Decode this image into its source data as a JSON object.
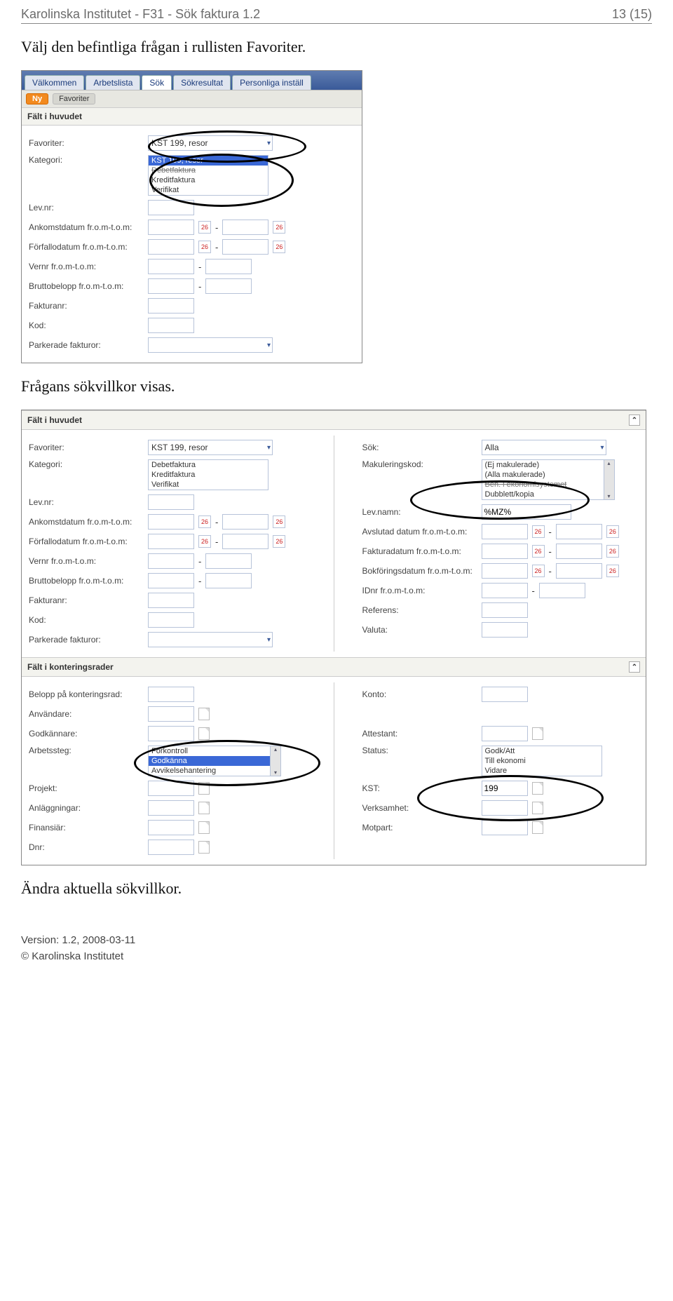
{
  "doc_header": {
    "title": "Karolinska Institutet - F31 - Sök faktura 1.2",
    "page_indicator": "13 (15)"
  },
  "intro_text": "Välj den befintliga frågan i rullisten Favoriter.",
  "mid_text": "Frågans sökvillkor visas.",
  "outro_text": "Ändra aktuella sökvillkor.",
  "footer": {
    "version": "Version: 1.2, 2008-03-11",
    "org": "Karolinska Institutet"
  },
  "shot1": {
    "tabs": [
      "Välkommen",
      "Arbetslista",
      "Sök",
      "Sökresultat",
      "Personliga inställ"
    ],
    "active_tab": 2,
    "sub_btn_ny": "Ny",
    "sub_btn_fav": "Favoriter",
    "section_title": "Fält i huvudet",
    "labels": {
      "favoriter": "Favoriter:",
      "kategori": "Kategori:",
      "levnr": "Lev.nr:",
      "ankomst": "Ankomstdatum fr.o.m-t.o.m:",
      "forfall": "Förfallodatum fr.o.m-t.o.m:",
      "vernr": "Vernr fr.o.m-t.o.m:",
      "brutto": "Bruttobelopp fr.o.m-t.o.m:",
      "fakturanr": "Fakturanr:",
      "kod": "Kod:",
      "parkerade": "Parkerade fakturor:"
    },
    "favoriter_value": "KST 199, resor",
    "kategori_options": [
      "KST 199, resor",
      "Debetfaktura",
      "Kreditfaktura",
      "Verifikat"
    ],
    "kategori_strike_index": 1
  },
  "shot2": {
    "section1": "Fält i huvudet",
    "section2": "Fält i konteringsrader",
    "left_labels": {
      "favoriter": "Favoriter:",
      "kategori": "Kategori:",
      "levnr": "Lev.nr:",
      "ankomst": "Ankomstdatum fr.o.m-t.o.m:",
      "forfall": "Förfallodatum fr.o.m-t.o.m:",
      "vernr": "Vernr fr.o.m-t.o.m:",
      "brutto": "Bruttobelopp fr.o.m-t.o.m:",
      "fakturanr": "Fakturanr:",
      "kod": "Kod:",
      "parkerade": "Parkerade fakturor:"
    },
    "right_labels": {
      "sok": "Sök:",
      "makul": "Makuleringskod:",
      "levnamn": "Lev.namn:",
      "avslutad": "Avslutad datum fr.o.m-t.o.m:",
      "fakturadatum": "Fakturadatum fr.o.m-t.o.m:",
      "bokforing": "Bokföringsdatum fr.o.m-t.o.m:",
      "idnr": "IDnr fr.o.m-t.o.m:",
      "referens": "Referens:",
      "valuta": "Valuta:"
    },
    "favoriter_value": "KST 199, resor",
    "kategori_options": [
      "Debetfaktura",
      "Kreditfaktura",
      "Verifikat"
    ],
    "sok_value": "Alla",
    "makul_options": [
      "(Ej makulerade)",
      "(Alla makulerade)",
      "Beh. i ekonomisystemet",
      "Dubblett/kopia"
    ],
    "makul_strike_index": 2,
    "levnamn_value": "%MZ%",
    "kont_left": {
      "belopp": "Belopp på konteringsrad:",
      "anvandare": "Användare:",
      "godkannare": "Godkännare:",
      "arbetssteg": "Arbetssteg:",
      "projekt": "Projekt:",
      "anlaggningar": "Anläggningar:",
      "finansiar": "Finansiär:",
      "dnr": "Dnr:"
    },
    "kont_right": {
      "konto": "Konto:",
      "attestant": "Attestant:",
      "status": "Status:",
      "kst": "KST:",
      "verksamhet": "Verksamhet:",
      "motpart": "Motpart:"
    },
    "arbetssteg_options": [
      "Förkontroll",
      "Godkänna",
      "Avvikelsehantering"
    ],
    "arbetssteg_selected": 1,
    "status_options": [
      "Godk/Att",
      "Till ekonomi",
      "Vidare"
    ],
    "kst_value": "199"
  }
}
